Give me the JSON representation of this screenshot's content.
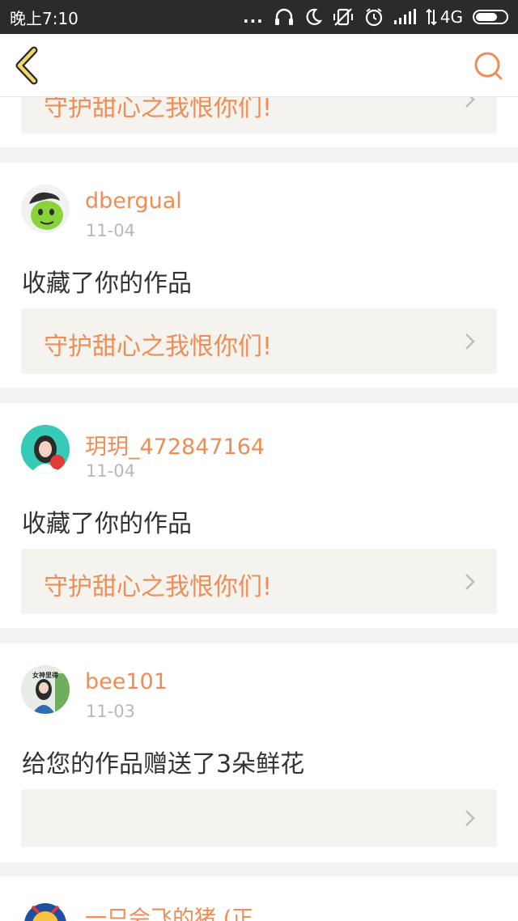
{
  "status_bar": {
    "time": "晚上7:10",
    "dots": "...",
    "network": "4G"
  },
  "nav": {
    "back_icon": "chevron-left-icon",
    "search_icon": "search-icon"
  },
  "top_partial": {
    "work_title": "守护甜心之我恨你们!"
  },
  "items": [
    {
      "username": "dbergual",
      "date": "11-04",
      "action": "收藏了你的作品",
      "work_title": "守护甜心之我恨你们!"
    },
    {
      "username": "玥玥_472847164",
      "date": "11-04",
      "action": "收藏了你的作品",
      "work_title": "守护甜心之我恨你们!"
    },
    {
      "username": "bee101",
      "date": "11-03",
      "action": "给您的作品赠送了3朵鲜花",
      "work_title": "",
      "avatar_badge": "女神里得"
    },
    {
      "username": "一只会飞的猪 (正"
    }
  ],
  "colors": {
    "accent": "#f08c55",
    "status_bar": "#2b2b2b",
    "separator": "#f2f2f2",
    "link_box": "#f4f3ee",
    "date": "#b8b8b8"
  }
}
